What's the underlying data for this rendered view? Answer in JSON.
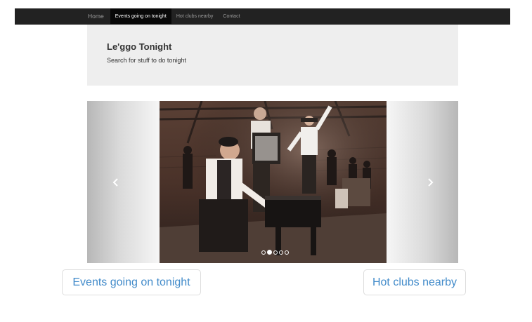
{
  "navbar": {
    "brand": "Home",
    "items": [
      {
        "label": "Events going on tonight",
        "active": true
      },
      {
        "label": "Hot clubs nearby",
        "active": false
      },
      {
        "label": "Contact",
        "active": false
      }
    ]
  },
  "jumbotron": {
    "title": "Le'ggo Tonight",
    "subtitle": "Search for stuff to do tonight"
  },
  "carousel": {
    "prev_icon": "chevron-left-icon",
    "next_icon": "chevron-right-icon",
    "slide_count": 5,
    "active_slide": 2
  },
  "buttons": {
    "events": "Events going on tonight",
    "clubs": "Hot clubs nearby"
  },
  "colors": {
    "navbar": "#222222",
    "jumbotron": "#eeeeee",
    "link": "#428bca"
  }
}
